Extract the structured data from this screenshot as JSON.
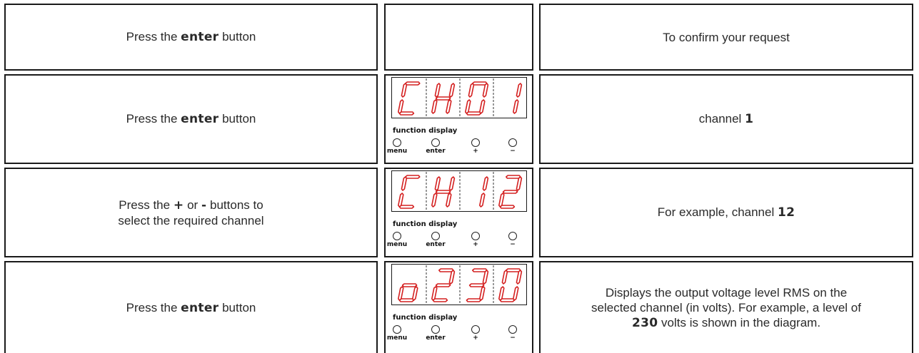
{
  "rows": [
    {
      "action_before": "Press the ",
      "action_bold": "enter",
      "action_after": " button",
      "result_before": "To confirm your request",
      "result_bold": "",
      "result_after": ""
    },
    {
      "action_before": "Press the ",
      "action_bold": "enter",
      "action_after": " button",
      "display": "CH01",
      "result_before": "channel ",
      "result_bold": "1",
      "result_after": ""
    },
    {
      "action_line1_before": "Press the ",
      "action_line1_plus": "+",
      "action_line1_mid": " or ",
      "action_line1_minus": "-",
      "action_line1_after": " buttons to",
      "action_line2": "select the required channel",
      "display": "CH12",
      "result_before": "For example, channel ",
      "result_bold": "12",
      "result_after": ""
    },
    {
      "action_before": "Press the ",
      "action_bold": "enter",
      "action_after": " button",
      "display": "o230",
      "result_line1": "Displays the output voltage level RMS on the",
      "result_line2": "selected channel (in volts). For example, a level of",
      "result_line3_bold": "230",
      "result_line3_after": " volts is shown in the diagram."
    }
  ],
  "panel": {
    "display_label": "function display",
    "buttons": [
      "menu",
      "enter",
      "+",
      "−"
    ]
  },
  "colors": {
    "segment": "#d42020",
    "border": "#1a1a1a"
  }
}
